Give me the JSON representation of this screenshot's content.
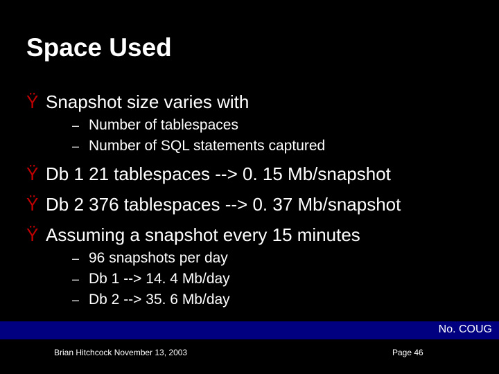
{
  "title": "Space Used",
  "bullets": [
    {
      "level": 1,
      "text": "Snapshot size varies with"
    },
    {
      "level": 2,
      "text": "Number of tablespaces"
    },
    {
      "level": 2,
      "text": "Number of SQL statements captured"
    },
    {
      "level": 1,
      "text": "Db 1 21 tablespaces --> 0. 15 Mb/snapshot"
    },
    {
      "level": 1,
      "text": "Db 2 376 tablespaces --> 0. 37 Mb/snapshot"
    },
    {
      "level": 1,
      "text": "Assuming a snapshot every 15 minutes"
    },
    {
      "level": 2,
      "text": "96 snapshots per day"
    },
    {
      "level": 2,
      "text": "Db 1 --> 14. 4 Mb/day"
    },
    {
      "level": 2,
      "text": "Db 2 --> 35. 6 Mb/day"
    }
  ],
  "glyphs": {
    "lvl1": "Ÿ",
    "lvl2": "–"
  },
  "footer": {
    "org": "No. COUG",
    "author": "Brian Hitchcock  November 13, 2003",
    "page": "Page 46"
  }
}
